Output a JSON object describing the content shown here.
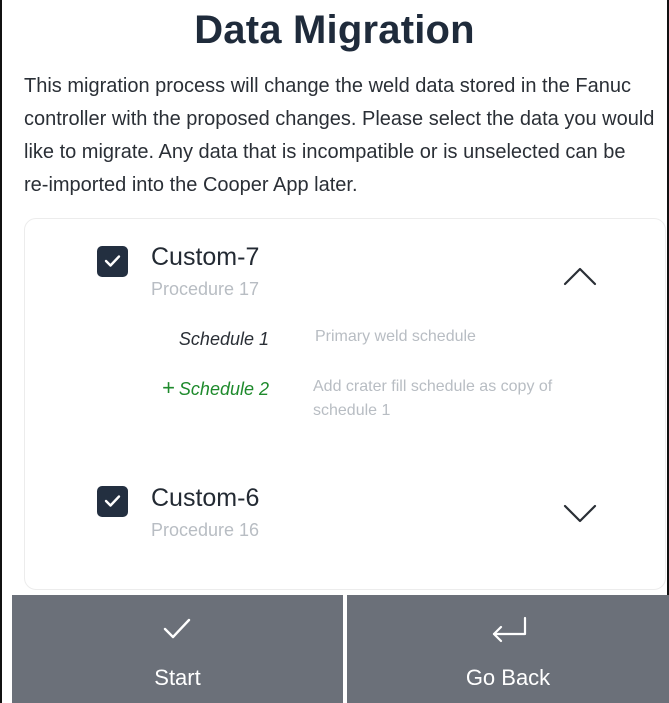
{
  "header": {
    "title": "Data Migration",
    "description": "This migration process will change the weld data stored in the Fanuc controller with the proposed changes. Please select the data you would like to migrate. Any data that is incompatible or is unselected can be re-imported into the Cooper App later."
  },
  "procedures": [
    {
      "name": "Custom-7",
      "subtitle": "Procedure 17",
      "checked": true,
      "expanded": true,
      "schedules": [
        {
          "name": "Schedule 1",
          "description": "Primary weld schedule",
          "added": false
        },
        {
          "name": "Schedule 2",
          "description": "Add crater fill schedule as copy of schedule 1",
          "added": true,
          "added_marker": "+"
        }
      ]
    },
    {
      "name": "Custom-6",
      "subtitle": "Procedure 16",
      "checked": true,
      "expanded": false
    }
  ],
  "footer": {
    "start_label": "Start",
    "go_back_label": "Go Back"
  },
  "colors": {
    "checkbox": "#232f40",
    "added_schedule": "#1e8a2c",
    "footer_bg": "#6b7079",
    "title": "#1f2b3b"
  },
  "icons": {
    "start": "check-icon",
    "go_back": "return-arrow-icon",
    "collapse": "chevron-up-icon",
    "expand": "chevron-down-icon"
  }
}
